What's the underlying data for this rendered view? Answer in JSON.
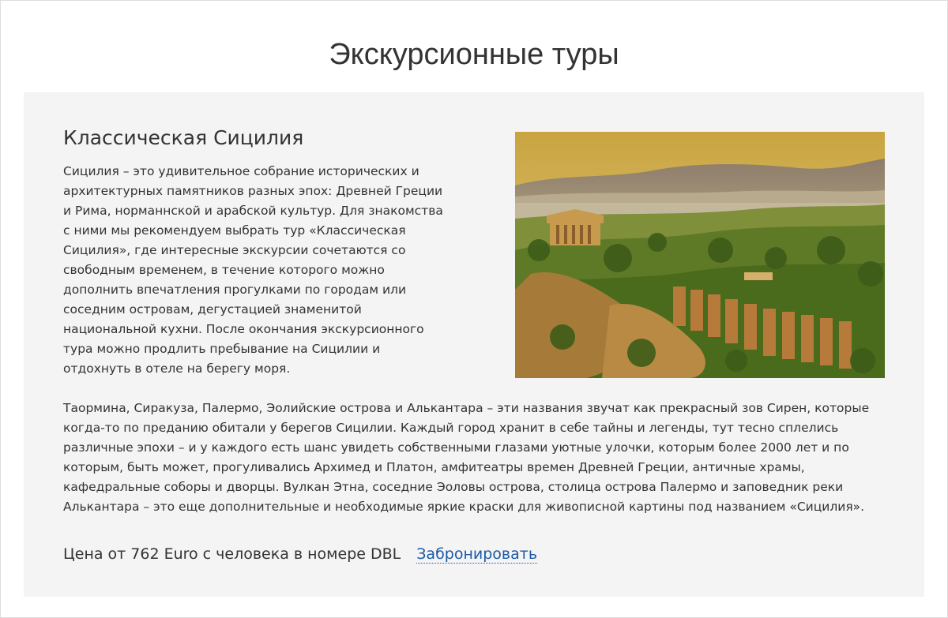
{
  "page": {
    "title": "Экскурсионные туры"
  },
  "tour": {
    "title": "Классическая Сицилия",
    "paragraph1": "Сицилия – это удивительное собрание исторических и архитектурных памятников разных эпох: Древней Греции и Рима, норманнской и арабской культур. Для знакомства с ними мы рекомендуем выбрать тур «Классическая Сицилия», где интересные экскурсии сочетаются со свободным временем, в течение которого можно дополнить впечатления прогулками по городам или соседним островам, дегустацией знаменитой национальной кухни. После окончания экскурсионного тура можно продлить пребывание на Сицилии и отдохнуть в отеле на берегу моря.",
    "paragraph2": "Таормина, Сиракуза, Палермо, Эолийские острова и Алькантара – эти названия звучат как прекрасный зов Сирен, которые когда-то по преданию обитали у берегов Сицилии. Каждый город хранит в себе тайны и легенды, тут тесно сплелись различные эпохи – и у каждого есть шанс увидеть собственными глазами уютные улочки, которым более 2000 лет и по которым, быть может, прогуливались Архимед и Платон, амфитеатры времен Древней Греции, античные храмы, кафедральные соборы и дворцы. Вулкан Этна, соседние Эоловы острова, столица острова Палермо и заповедник реки Алькантара – это еще дополнительные и необходимые яркие краски для живописной картины под названием «Сицилия».",
    "price": "Цена от 762 Euro с человека в номере DBL",
    "book_label": "Забронировать"
  },
  "colors": {
    "card_background": "#f4f4f4",
    "link": "#1a5aa6",
    "text": "#333333"
  }
}
